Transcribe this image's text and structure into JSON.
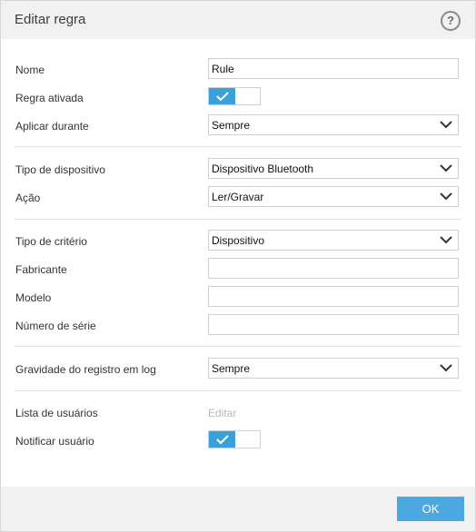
{
  "dialog": {
    "title": "Editar regra",
    "help_glyph": "?"
  },
  "form": {
    "name": {
      "label": "Nome",
      "value": "Rule"
    },
    "enabled": {
      "label": "Regra ativada",
      "on": true
    },
    "apply_during": {
      "label": "Aplicar durante",
      "value": "Sempre"
    },
    "device_type": {
      "label": "Tipo de dispositivo",
      "value": "Dispositivo Bluetooth"
    },
    "action": {
      "label": "Ação",
      "value": "Ler/Gravar"
    },
    "criteria_type": {
      "label": "Tipo de critério",
      "value": "Dispositivo"
    },
    "manufacturer": {
      "label": "Fabricante",
      "value": ""
    },
    "model": {
      "label": "Modelo",
      "value": ""
    },
    "serial": {
      "label": "Número de série",
      "value": ""
    },
    "log_severity": {
      "label": "Gravidade do registro em log",
      "value": "Sempre"
    },
    "user_list": {
      "label": "Lista de usuários",
      "link": "Editar"
    },
    "notify_user": {
      "label": "Notificar usuário",
      "on": true
    }
  },
  "footer": {
    "ok_label": "OK"
  },
  "colors": {
    "accent": "#3aa0d9",
    "ok_button": "#4ba8e0",
    "header_bg": "#f1f1f1"
  },
  "icons": {
    "help": "help-icon",
    "dropdown": "chevron-down-icon",
    "toggle": "check-icon"
  }
}
